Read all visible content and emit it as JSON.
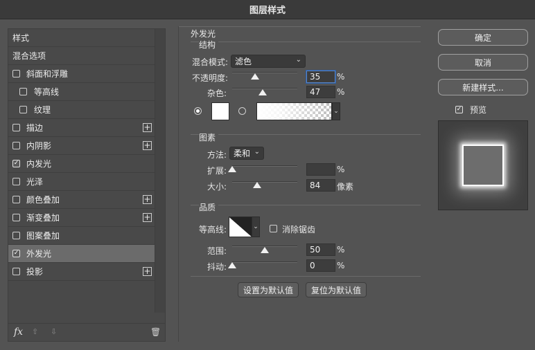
{
  "window": {
    "title": "图层样式"
  },
  "left": {
    "header": "样式",
    "blend_options": "混合选项",
    "items": [
      {
        "label": "斜面和浮雕",
        "checked": false,
        "plus": false,
        "sub": false
      },
      {
        "label": "等高线",
        "checked": false,
        "plus": false,
        "sub": true
      },
      {
        "label": "纹理",
        "checked": false,
        "plus": false,
        "sub": true
      },
      {
        "label": "描边",
        "checked": false,
        "plus": true,
        "sub": false
      },
      {
        "label": "内阴影",
        "checked": false,
        "plus": true,
        "sub": false
      },
      {
        "label": "内发光",
        "checked": true,
        "plus": false,
        "sub": false
      },
      {
        "label": "光泽",
        "checked": false,
        "plus": false,
        "sub": false
      },
      {
        "label": "颜色叠加",
        "checked": false,
        "plus": true,
        "sub": false
      },
      {
        "label": "渐变叠加",
        "checked": false,
        "plus": true,
        "sub": false
      },
      {
        "label": "图案叠加",
        "checked": false,
        "plus": false,
        "sub": false
      },
      {
        "label": "外发光",
        "checked": true,
        "plus": false,
        "sub": false,
        "active": true
      },
      {
        "label": "投影",
        "checked": false,
        "plus": true,
        "sub": false
      }
    ],
    "footer": {
      "fx": "fx",
      "fx_icon": "fx-icon",
      "up_icon": "arrow-up-icon",
      "down_icon": "arrow-down-icon",
      "trash_icon": "trash-icon"
    }
  },
  "panel_title": "外发光",
  "structure": {
    "title": "结构",
    "blend_mode_label": "混合模式:",
    "blend_mode_value": "滤色",
    "opacity_label": "不透明度:",
    "opacity_value": "35",
    "opacity_unit": "%",
    "noise_label": "杂色:",
    "noise_value": "47",
    "noise_unit": "%"
  },
  "elements": {
    "title": "图素",
    "method_label": "方法:",
    "method_value": "柔和",
    "spread_label": "扩展:",
    "spread_value": "",
    "spread_unit": "%",
    "size_label": "大小:",
    "size_value": "84",
    "size_unit": "像素"
  },
  "quality": {
    "title": "品质",
    "contour_label": "等高线:",
    "antialias_label": "消除锯齿",
    "antialias_checked": false,
    "range_label": "范围:",
    "range_value": "50",
    "range_unit": "%",
    "jitter_label": "抖动:",
    "jitter_value": "0",
    "jitter_unit": "%"
  },
  "buttons": {
    "set_default": "设置为默认值",
    "reset_default": "复位为默认值",
    "ok": "确定",
    "cancel": "取消",
    "new_style": "新建样式...",
    "preview_label": "预览",
    "preview_checked": true
  },
  "colors": {
    "accent_focus": "#5a86c8",
    "glow_color": "#ffffff"
  }
}
